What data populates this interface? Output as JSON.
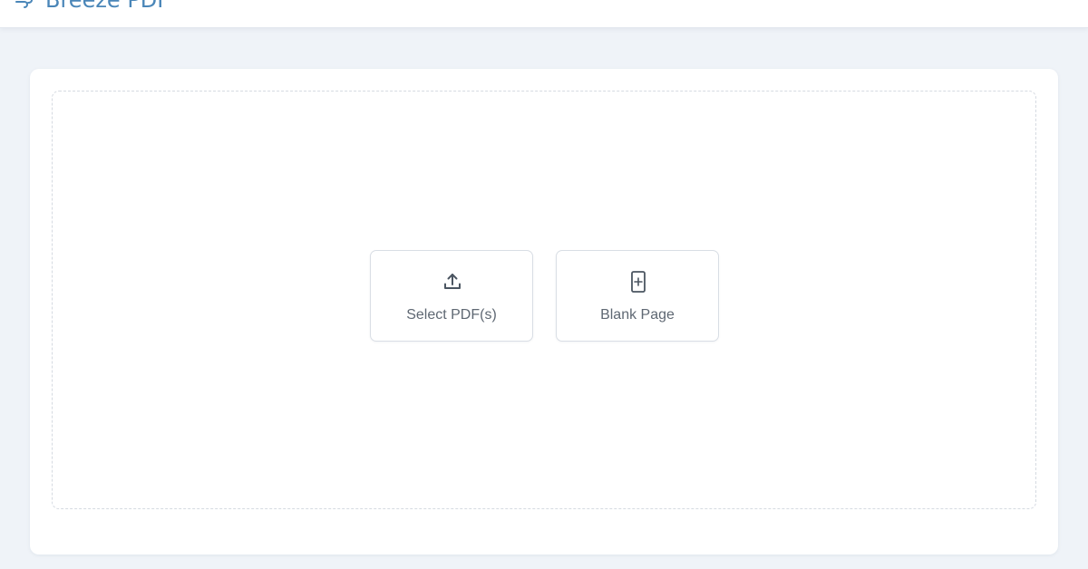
{
  "app": {
    "name": "Breeze PDF",
    "brand_icon": "breeze-icon",
    "brand_color": "#4a86b8"
  },
  "upload_panel": {
    "actions": [
      {
        "label": "Select PDF(s)",
        "icon": "upload-icon"
      },
      {
        "label": "Blank Page",
        "icon": "blank-page-plus-icon"
      }
    ]
  },
  "colors": {
    "background": "#eff3f8",
    "card_background": "#ffffff",
    "dashed_border": "#d5dae1",
    "button_text": "#5f6873",
    "icon": "#4b5561"
  }
}
